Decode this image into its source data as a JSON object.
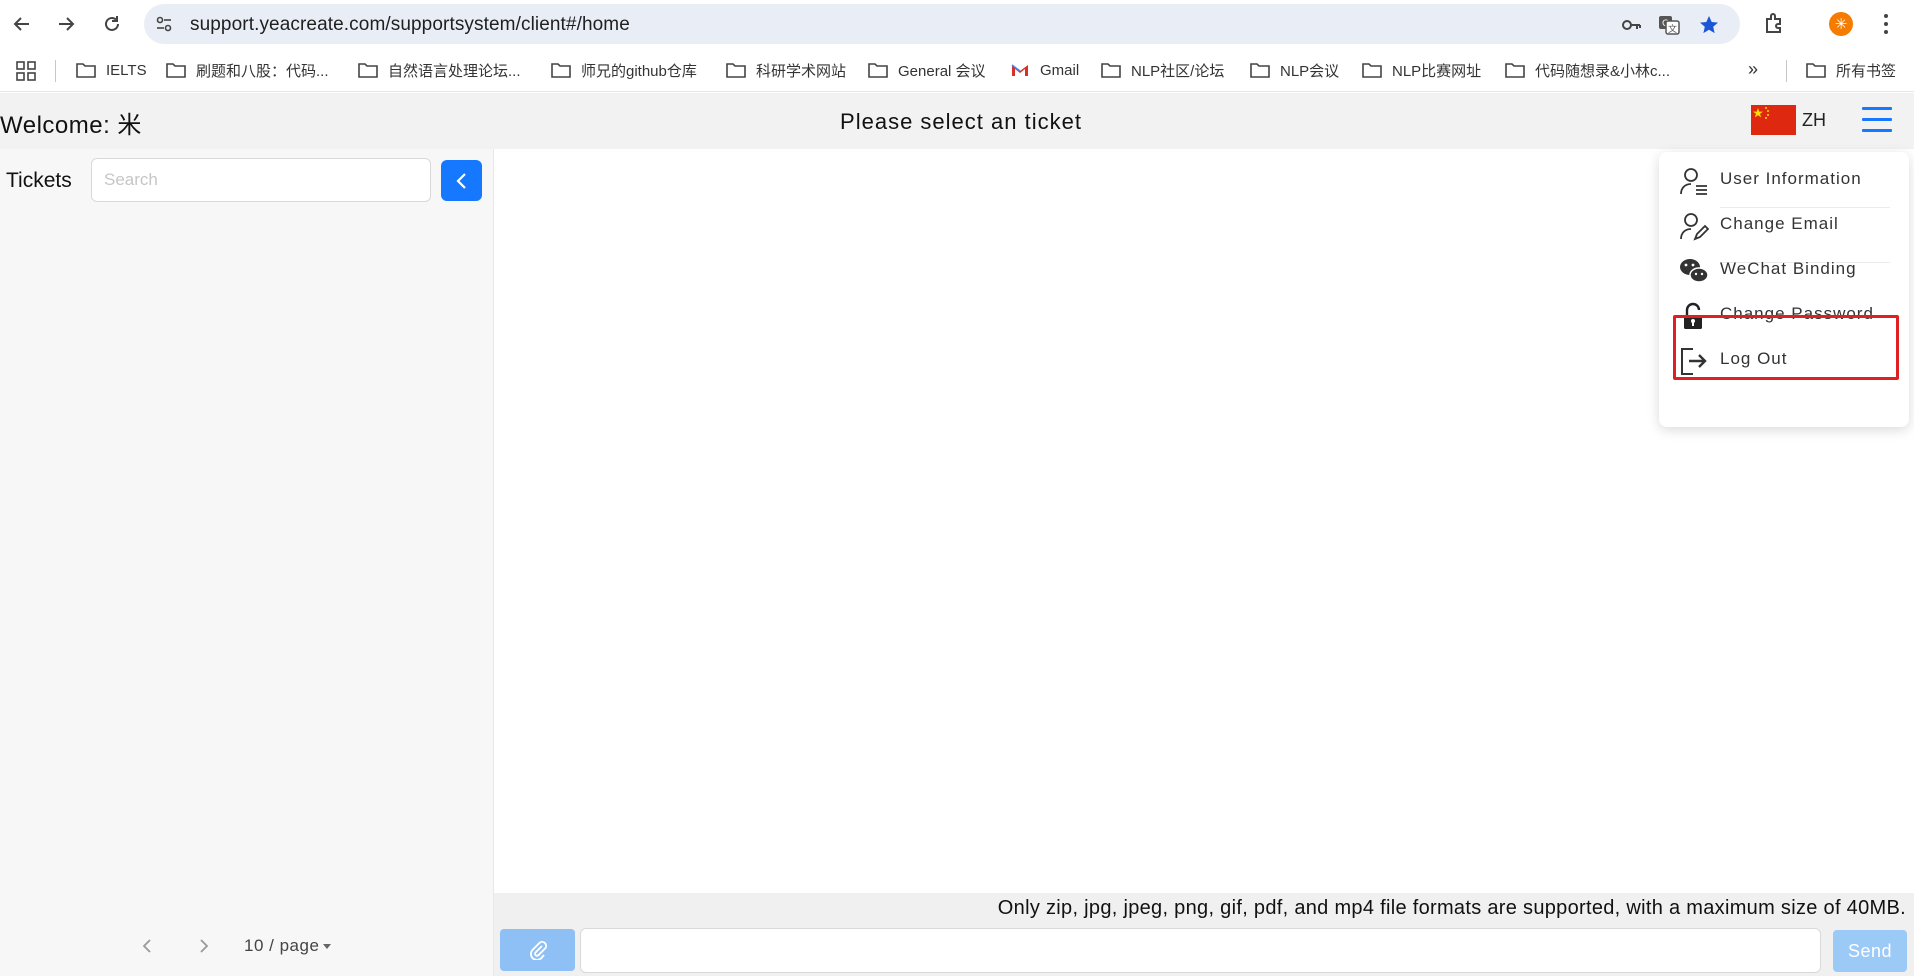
{
  "browser": {
    "url": "support.yeacreate.com/supportsystem/client#/home",
    "profile_initial": "✳",
    "bookmarks": [
      "IELTS",
      "刷题和八股：代码...",
      "自然语言处理论坛...",
      "师兄的github仓库",
      "科研学术网站",
      "General 会议",
      "Gmail",
      "NLP社区/论坛",
      "NLP会议",
      "NLP比赛网址",
      "代码随想录&小林c...",
      "»",
      "所有书签"
    ]
  },
  "header": {
    "welcome": "Welcome: 米",
    "title": "Please select an ticket",
    "lang": "ZH"
  },
  "sidebar": {
    "label": "Tickets",
    "search_placeholder": "Search",
    "page_size": "10 / page"
  },
  "main": {
    "notice": "Only zip, jpg, jpeg, png, gif, pdf, and mp4 file formats are supported, with a maximum size of 40MB.",
    "send_label": "Send"
  },
  "menu": {
    "items": [
      {
        "label": "User Information",
        "icon": "user-info-icon"
      },
      {
        "label": "Change Email",
        "icon": "edit-user-icon"
      },
      {
        "label": "WeChat Binding",
        "icon": "wechat-icon"
      },
      {
        "label": "Change Password",
        "icon": "lock-icon"
      },
      {
        "label": "Log Out",
        "icon": "logout-icon"
      }
    ],
    "highlighted": "Change Password"
  },
  "colors": {
    "accent": "#1677ff",
    "highlight": "#e02020",
    "flag": "#de2910"
  }
}
